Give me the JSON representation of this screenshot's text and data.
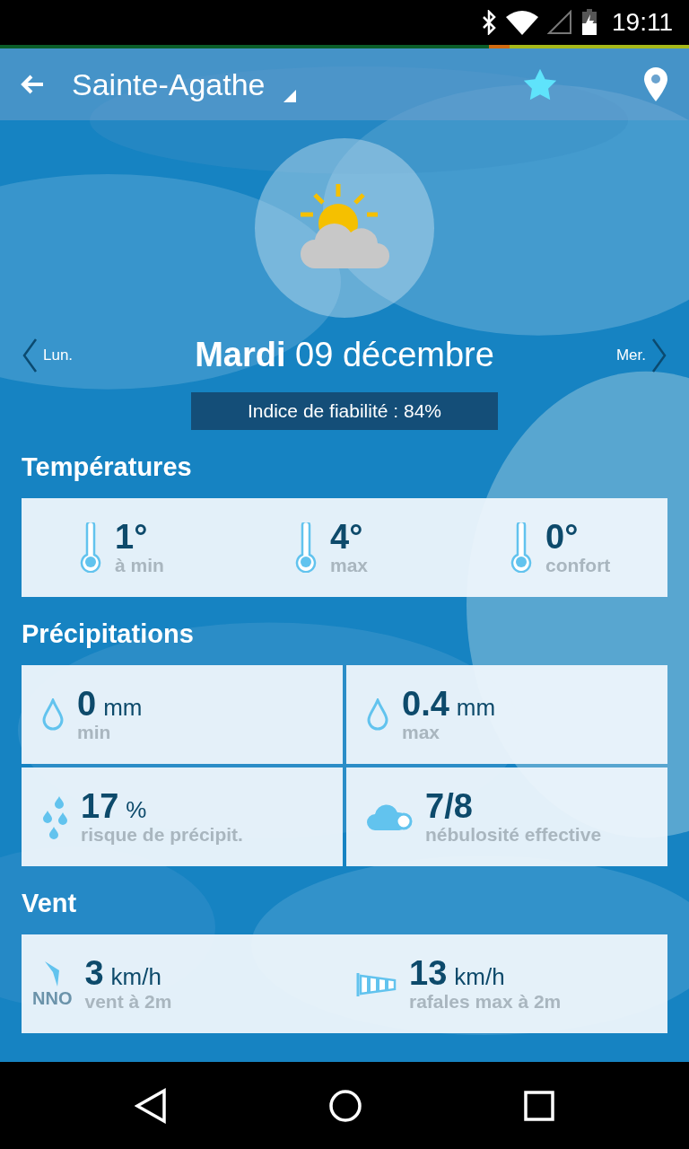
{
  "status_bar": {
    "time": "19:11"
  },
  "header": {
    "title": "Sainte-Agathe"
  },
  "day_nav": {
    "previous": "Lun.",
    "day": "Mardi",
    "date": "09 décembre",
    "next": "Mer."
  },
  "reliability": "Indice de fiabilité : 84%",
  "sections": [
    {
      "title": "Températures",
      "kind": "row",
      "items": [
        {
          "kind": "thermometer",
          "value": "1°",
          "label": "à min"
        },
        {
          "kind": "thermometer",
          "value": "4°",
          "label": "max"
        },
        {
          "kind": "thermometer",
          "value": "0°",
          "label": "confort"
        }
      ]
    },
    {
      "title": "Précipitations",
      "kind": "grid",
      "items": [
        {
          "kind": "drop",
          "value": "0",
          "unit": "mm",
          "label": "min"
        },
        {
          "kind": "drop",
          "value": "0.4",
          "unit": "mm",
          "label": "max"
        },
        {
          "kind": "drops",
          "value": "17",
          "unit": "%",
          "label": "risque de précipit."
        },
        {
          "kind": "cloud",
          "value": "7/8",
          "label": "nébulosité effective"
        }
      ]
    },
    {
      "title": "Vent",
      "kind": "row",
      "items": [
        {
          "kind": "wind",
          "direction": "NNO",
          "value": "3",
          "unit": "km/h",
          "label": "vent à 2m"
        },
        {
          "kind": "gusts",
          "value": "13",
          "unit": "km/h",
          "label": "rafales max à 2m"
        }
      ]
    }
  ]
}
